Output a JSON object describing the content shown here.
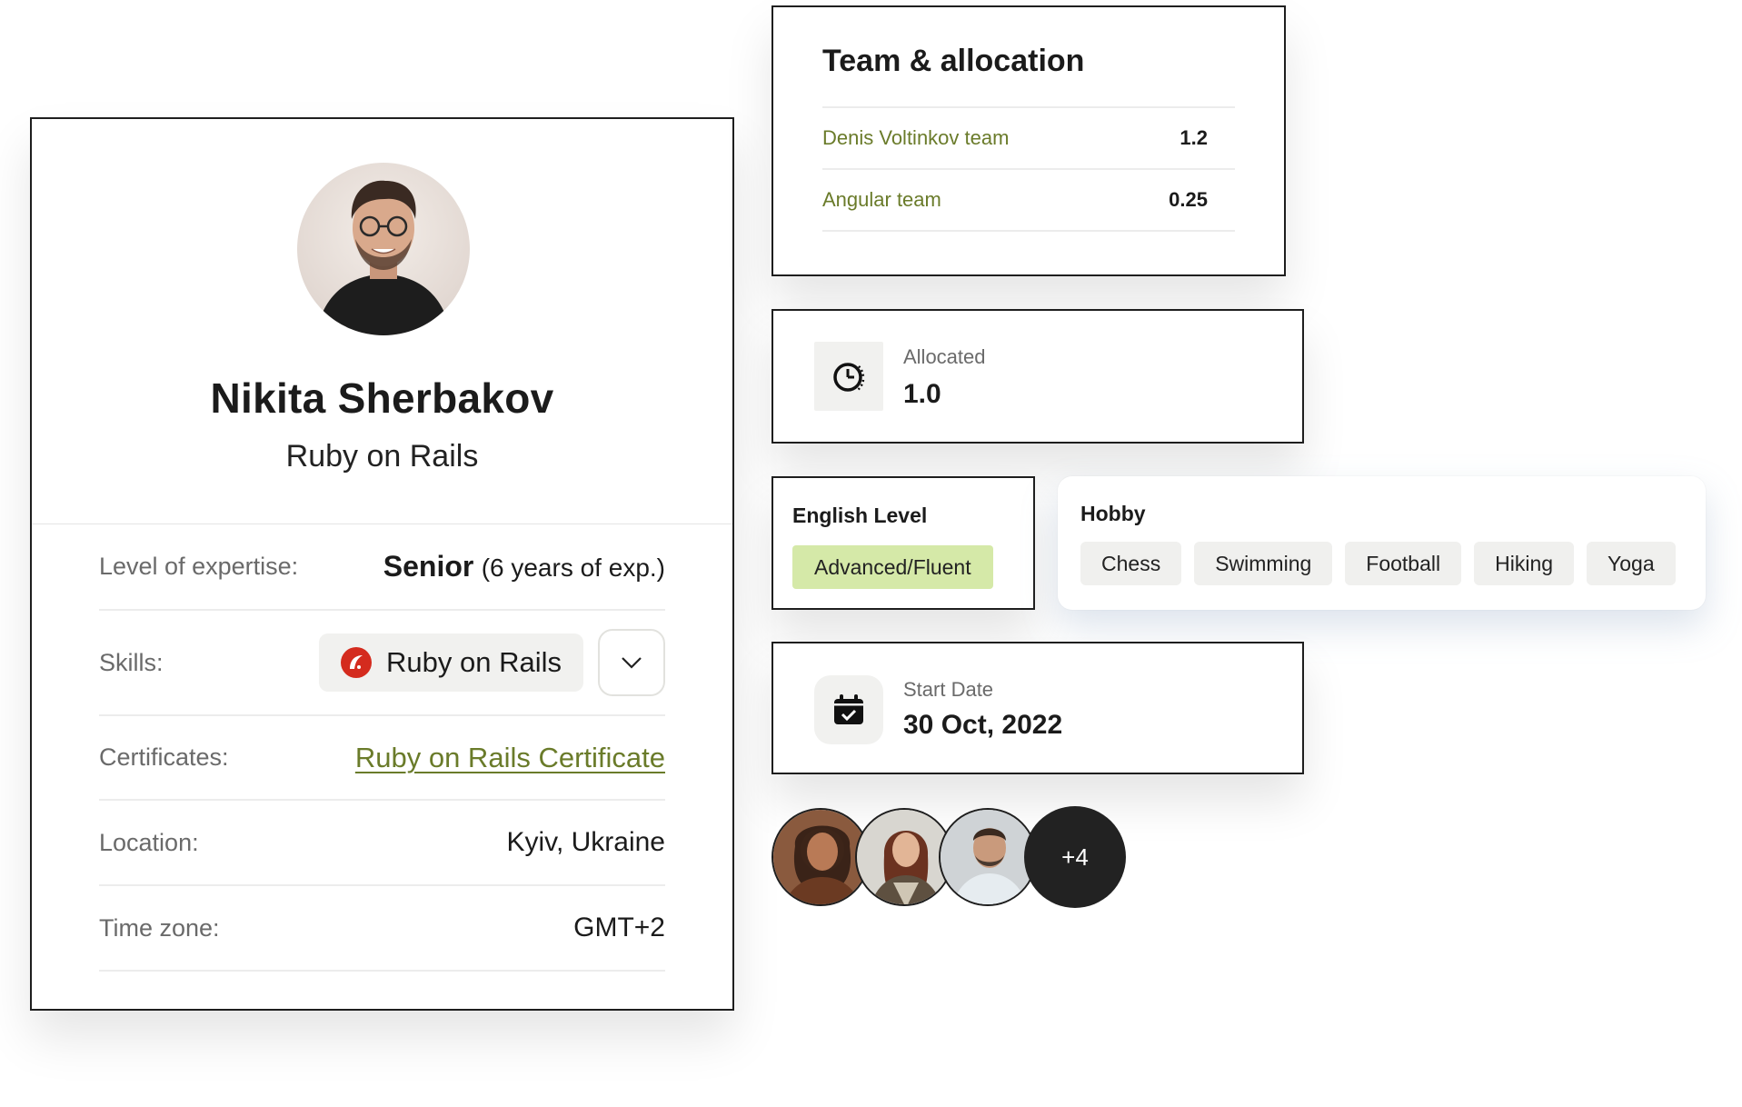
{
  "profile": {
    "name": "Nikita Sherbakov",
    "role": "Ruby on Rails",
    "expertise_label": "Level of expertise:",
    "expertise_level": "Senior",
    "expertise_years": "(6 years of exp.)",
    "skills_label": "Skills:",
    "skill": "Ruby on Rails",
    "certificates_label": "Certificates:",
    "certificate": "Ruby on Rails Certificate",
    "location_label": "Location:",
    "location": "Kyiv, Ukraine",
    "timezone_label": "Time zone:",
    "timezone": "GMT+2"
  },
  "team": {
    "title": "Team & allocation",
    "rows": [
      {
        "name": "Denis Voltinkov team",
        "value": "1.2"
      },
      {
        "name": "Angular team",
        "value": "0.25"
      }
    ]
  },
  "allocated": {
    "label": "Allocated",
    "value": "1.0"
  },
  "english": {
    "label": "English Level",
    "value": "Advanced/Fluent"
  },
  "hobby": {
    "label": "Hobby",
    "items": [
      "Chess",
      "Swimming",
      "Football",
      "Hiking",
      "Yoga"
    ]
  },
  "start_date": {
    "label": "Start Date",
    "value": "30 Oct, 2022"
  },
  "members": {
    "more": "+4"
  },
  "colors": {
    "accent_link": "#6a7b2a",
    "badge_green": "#d5e9a8",
    "rails_red": "#d42b1e",
    "dark": "#1e1e1e"
  }
}
